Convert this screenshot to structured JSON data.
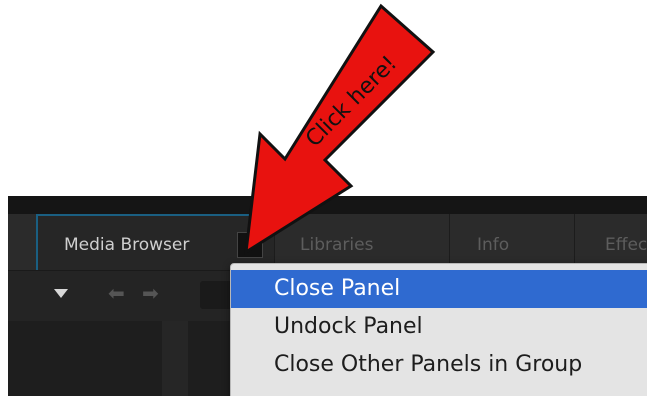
{
  "panel": {
    "tabs": [
      {
        "label": "Media Browser"
      },
      {
        "label": "Libraries"
      },
      {
        "label": "Info"
      },
      {
        "label": "Effec"
      }
    ],
    "menu_button_glyph": "≡"
  },
  "toolbar": {
    "icons": [
      "dropdown-icon",
      "back-arrow-icon",
      "forward-arrow-icon"
    ]
  },
  "context_menu": {
    "items": [
      {
        "label": "Close Panel",
        "highlighted": true
      },
      {
        "label": "Undock Panel",
        "highlighted": false
      },
      {
        "label": "Close Other Panels in Group",
        "highlighted": false
      }
    ]
  },
  "annotation": {
    "text": "Click here!",
    "color": "#e8120f"
  },
  "colors": {
    "highlight": "#2f6ad0",
    "active_tab_border": "#1a5f82",
    "panel_bg": "#2b2b2b",
    "menu_bg": "#e4e4e4"
  }
}
